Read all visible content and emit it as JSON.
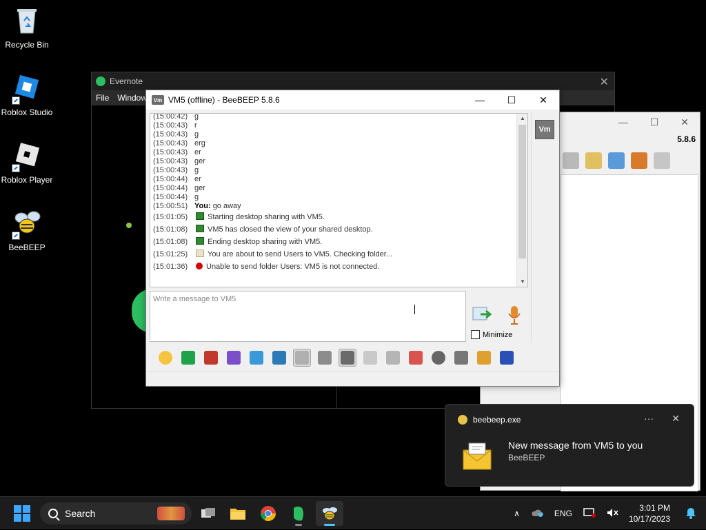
{
  "desktop_icons": [
    {
      "label": "Recycle Bin",
      "icon": "recycle-bin-icon"
    },
    {
      "label": "Roblox Studio",
      "icon": "roblox-studio-icon"
    },
    {
      "label": "Roblox Player",
      "icon": "roblox-player-icon"
    },
    {
      "label": "BeeBEEP",
      "icon": "beebeep-icon"
    }
  ],
  "evernote": {
    "title": "Evernote",
    "menu": [
      "File",
      "Window"
    ]
  },
  "beebeep_bg": {
    "version": "5.8.6"
  },
  "chat_window": {
    "title": "VM5 (offline) - BeeBEEP 5.8.6",
    "logo_text": "Vm",
    "log": [
      {
        "time": "(15:00:42)",
        "text": "g"
      },
      {
        "time": "(15:00:43)",
        "text": "r"
      },
      {
        "time": "(15:00:43)",
        "text": "g"
      },
      {
        "time": "(15:00:43)",
        "text": "erg"
      },
      {
        "time": "(15:00:43)",
        "text": "er"
      },
      {
        "time": "(15:00:43)",
        "text": "ger"
      },
      {
        "time": "(15:00:43)",
        "text": "g"
      },
      {
        "time": "(15:00:44)",
        "text": "er"
      },
      {
        "time": "(15:00:44)",
        "text": "ger"
      },
      {
        "time": "(15:00:44)",
        "text": "g"
      },
      {
        "time": "(15:00:51)",
        "sender": "You:",
        "text": "go away"
      },
      {
        "time": "(15:01:05)",
        "icon": "desktop-share-icon",
        "text": "Starting desktop sharing with VM5."
      },
      {
        "time": "(15:01:08)",
        "icon": "desktop-share-icon",
        "text": "VM5 has closed the view of your shared desktop."
      },
      {
        "time": "(15:01:08)",
        "icon": "desktop-share-icon",
        "text": "Ending desktop sharing with VM5."
      },
      {
        "time": "(15:01:25)",
        "icon": "folder-send-icon",
        "text": "You are about to send Users to VM5. Checking folder..."
      },
      {
        "time": "(15:01:36)",
        "icon": "error-icon",
        "text": "Unable to send folder Users: VM5 is not connected."
      }
    ],
    "message_placeholder": "Write a message to VM5",
    "minimize_label": "Minimize",
    "toolbar_icons": [
      "emoticon-icon",
      "green-arrow-icon",
      "font-icon",
      "color-icon",
      "filter-icon",
      "settings-icon",
      "spellcheck-icon",
      "text-icon",
      "music-note-icon",
      "document-icon",
      "send-file-icon",
      "code-icon",
      "record-icon",
      "screenshot-icon",
      "notes-icon",
      "save-icon"
    ]
  },
  "toast": {
    "app_name": "beebeep.exe",
    "more": "···",
    "headline": "New message from VM5 to you",
    "source": "BeeBEEP"
  },
  "taskbar": {
    "search_label": "Search",
    "language": "ENG",
    "time": "3:01 PM",
    "date": "10/17/2023"
  },
  "colors": {
    "accent": "#3ea6ff",
    "error": "#d40000",
    "taskbar_bg": "#1c1c1c"
  }
}
